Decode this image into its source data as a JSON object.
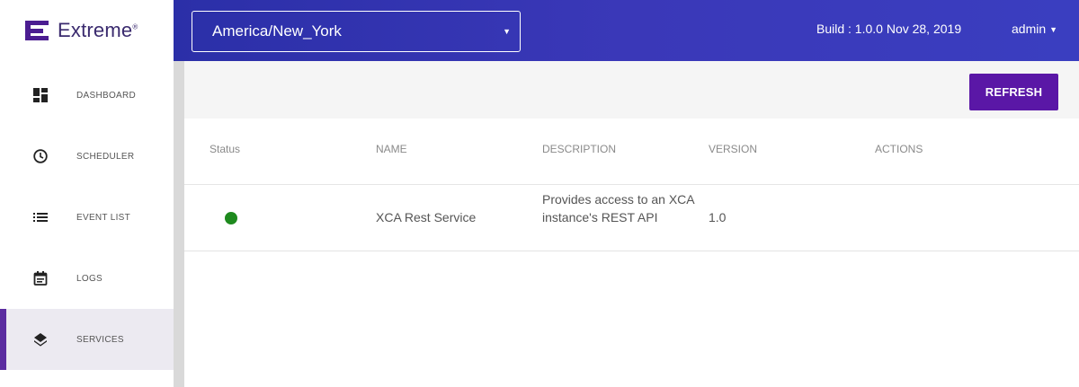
{
  "brand": {
    "name": "Extreme",
    "mark": "®"
  },
  "nav": {
    "items": [
      {
        "label": "DASHBOARD",
        "icon": "dashboard-icon"
      },
      {
        "label": "SCHEDULER",
        "icon": "clock-icon"
      },
      {
        "label": "EVENT LIST",
        "icon": "list-icon"
      },
      {
        "label": "LOGS",
        "icon": "calendar-icon"
      },
      {
        "label": "SERVICES",
        "icon": "layers-icon",
        "active": true
      }
    ]
  },
  "header": {
    "timezone": "America/New_York",
    "build": "Build : 1.0.0 Nov 28, 2019",
    "user": "admin"
  },
  "toolbar": {
    "refresh_label": "REFRESH"
  },
  "table": {
    "columns": [
      "Status",
      "NAME",
      "DESCRIPTION",
      "VERSION",
      "ACTIONS"
    ],
    "rows": [
      {
        "status": "running",
        "name": "XCA Rest Service",
        "description": "Provides access to an XCA instance's REST API",
        "version": "1.0",
        "actions": ""
      }
    ]
  },
  "colors": {
    "accent": "#5a17a6",
    "topbar": "#3a38b8",
    "status_ok": "#1e8a1e"
  }
}
